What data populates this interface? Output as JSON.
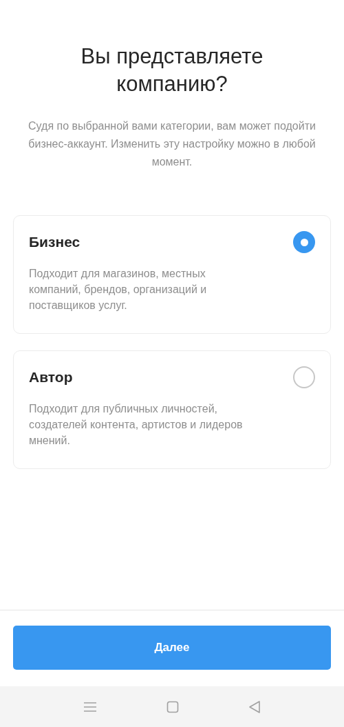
{
  "title": "Вы представляете компанию?",
  "subtitle": "Судя по выбранной вами категории, вам может подойти бизнес-аккаунт. Изменить эту настройку можно в любой момент.",
  "options": [
    {
      "title": "Бизнес",
      "description": "Подходит для магазинов, местных компаний, брендов, организаций и поставщиков услуг.",
      "selected": true
    },
    {
      "title": "Автор",
      "description": "Подходит для публичных личностей, создателей контента, артистов и лидеров мнений.",
      "selected": false
    }
  ],
  "button": {
    "label": "Далее"
  }
}
